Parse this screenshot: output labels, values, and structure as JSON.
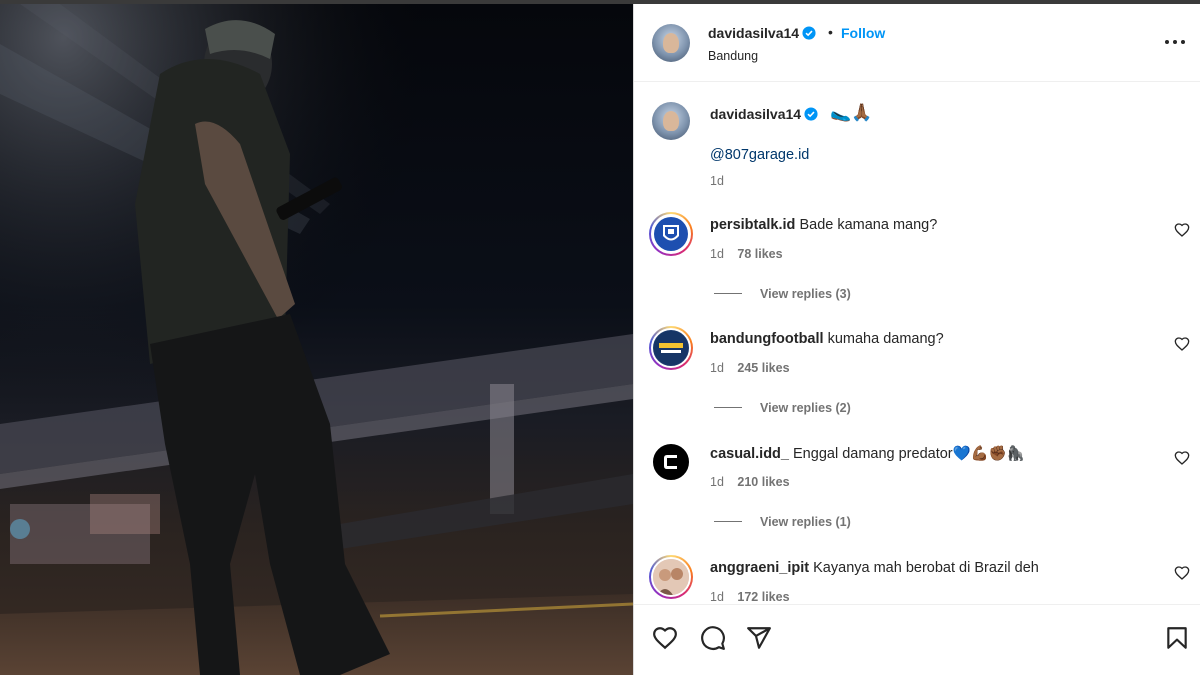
{
  "post": {
    "username": "davidasilva14",
    "location": "Bandung",
    "follow_label": "Follow",
    "separator": "•"
  },
  "caption": {
    "username": "davidasilva14",
    "emoji": "🥿🙏🏾",
    "mention": "@807garage.id",
    "time": "1d"
  },
  "comments": [
    {
      "username": "persibtalk.id",
      "text": "Bade kamana mang?",
      "time": "1d",
      "likes": "78 likes",
      "replies": "View replies (3)"
    },
    {
      "username": "bandungfootball",
      "text": "kumaha damang?",
      "time": "1d",
      "likes": "245 likes",
      "replies": "View replies (2)"
    },
    {
      "username": "casual.idd_",
      "text": "Enggal damang predator💙💪🏾✊🏾🦍",
      "time": "1d",
      "likes": "210 likes",
      "replies": "View replies (1)"
    },
    {
      "username": "anggraeni_ipit",
      "text": "Kayanya mah berobat di Brazil deh",
      "time": "1d",
      "likes": "172 likes",
      "replies": ""
    }
  ],
  "icons": {
    "verified": "verified-badge-icon",
    "more": "more-options-icon",
    "like": "heart-icon",
    "comment": "comment-icon",
    "share": "share-icon",
    "save": "bookmark-icon"
  },
  "colors": {
    "accent": "#0095f6",
    "verified": "#0095f6",
    "link": "#00376b",
    "muted": "#737373"
  }
}
